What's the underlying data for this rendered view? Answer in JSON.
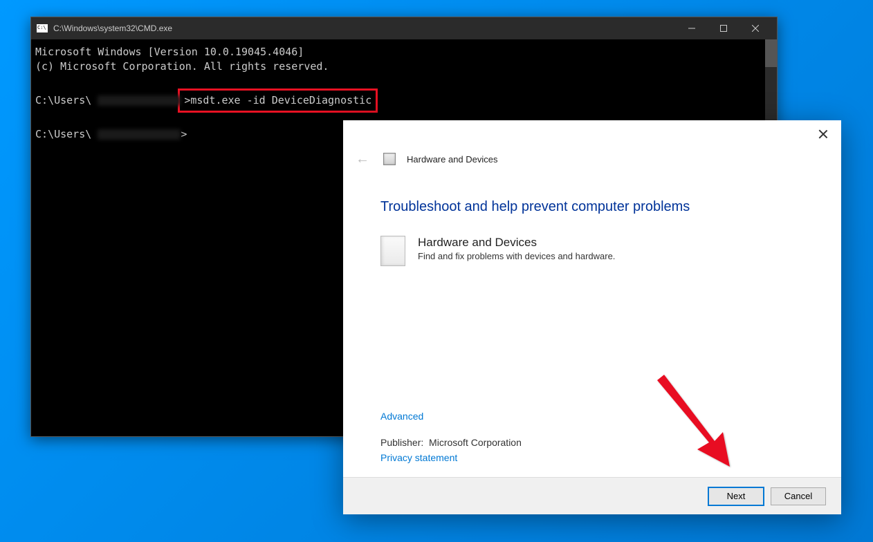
{
  "cmd": {
    "title": "C:\\Windows\\system32\\CMD.exe",
    "line1": "Microsoft Windows [Version 10.0.19045.4046]",
    "line2": "(c) Microsoft Corporation. All rights reserved.",
    "prompt_prefix": "C:\\Users\\",
    "prompt_char": ">",
    "command": "msdt.exe -id DeviceDiagnostic"
  },
  "dialog": {
    "header_title": "Hardware and Devices",
    "title": "Troubleshoot and help prevent computer problems",
    "item_title": "Hardware and Devices",
    "item_desc": "Find and fix problems with devices and hardware.",
    "advanced": "Advanced",
    "publisher_label": "Publisher:",
    "publisher_value": "Microsoft Corporation",
    "privacy": "Privacy statement",
    "next": "Next",
    "cancel": "Cancel"
  }
}
